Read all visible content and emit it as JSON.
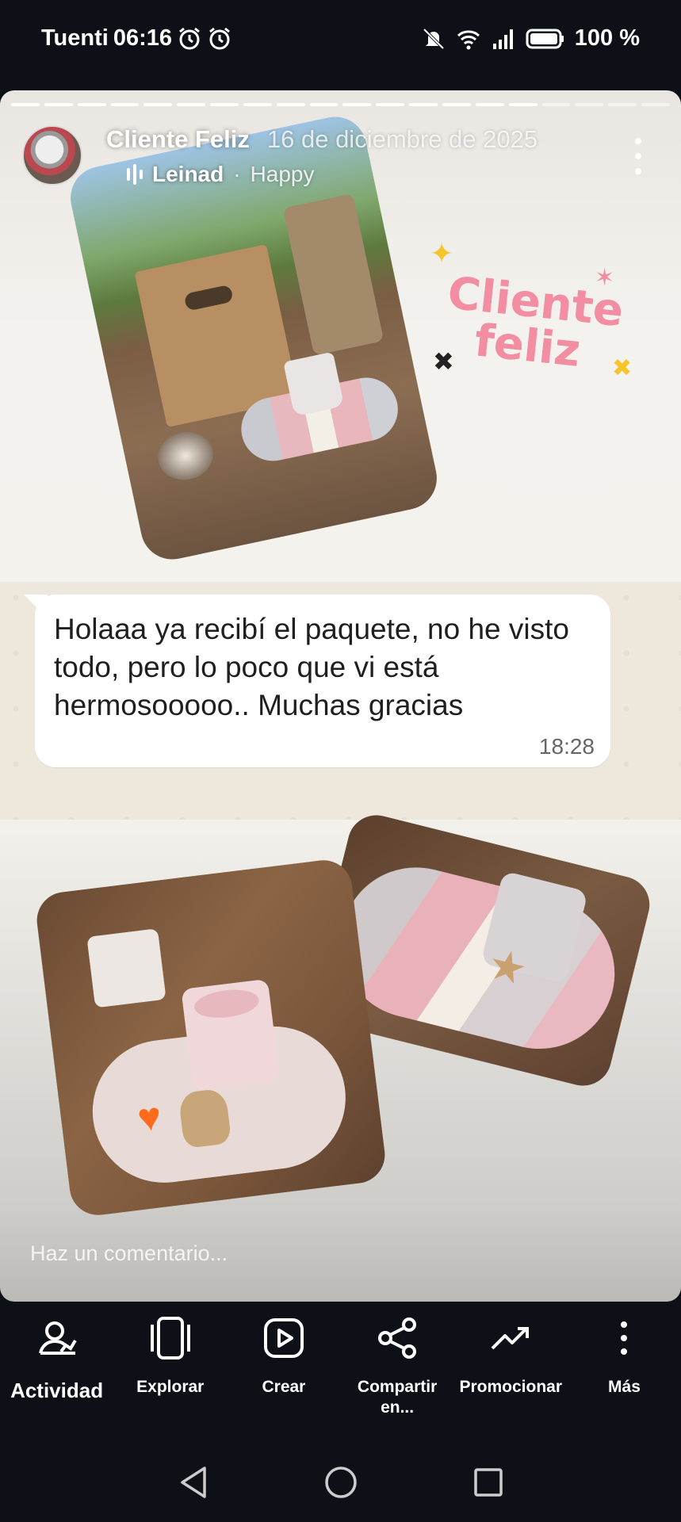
{
  "status_bar": {
    "carrier": "Tuenti",
    "time": "06:16",
    "battery": "100 %",
    "icons": [
      "alarm-icon",
      "alarm-icon",
      "mute-icon",
      "wifi-icon",
      "signal-icon",
      "battery-icon"
    ]
  },
  "story": {
    "progress_segments": 20,
    "progress_done": 16,
    "author_name": "Cliente Feliz",
    "date": "16 de diciembre de 2025",
    "music_artist": "Leinad",
    "music_separator": "·",
    "music_song": "Happy",
    "sticker_line1": "Cliente",
    "sticker_line2": "feliz",
    "sticker_color": "#f38ea2",
    "chat_message": "Holaaa ya recibí el paquete, no he visto todo, pero lo poco que vi está hermosooooo.. Muchas gracias",
    "chat_time": "18:28",
    "comment_placeholder": "Haz un comentario..."
  },
  "actions": [
    {
      "label": "Actividad",
      "icon": "activity-icon"
    },
    {
      "label": "Explorar",
      "icon": "explore-icon"
    },
    {
      "label": "Crear",
      "icon": "create-icon"
    },
    {
      "label": "Compartir en...",
      "icon": "share-icon"
    },
    {
      "label": "Promocionar",
      "icon": "promote-icon"
    },
    {
      "label": "Más",
      "icon": "more-icon"
    }
  ],
  "navbar": [
    "back-icon",
    "home-icon",
    "recents-icon"
  ]
}
